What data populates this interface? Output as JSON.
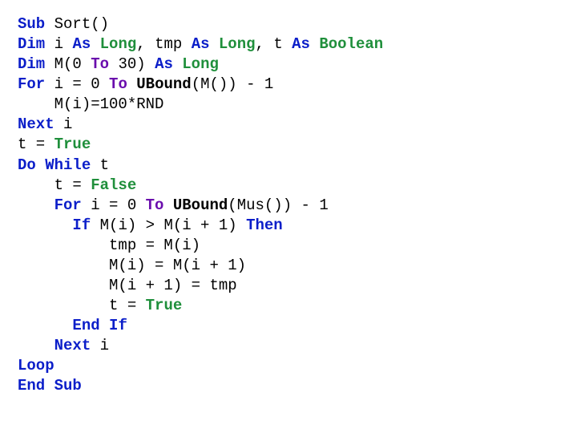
{
  "code": {
    "line1": {
      "sub": "Sub",
      "name": " Sort()"
    },
    "line2": {
      "dim": "Dim",
      "seg1": " i ",
      "as1": "As",
      "sp1": " ",
      "t1": "Long",
      "c1": ", tmp ",
      "as2": "As",
      "sp2": " ",
      "t2": "Long",
      "c2": ", t ",
      "as3": "As",
      "sp3": " ",
      "t3": "Boolean"
    },
    "line3": {
      "dim": "Dim",
      "seg": " M(0 ",
      "to": "To",
      "seg2": " 30) ",
      "as": "As",
      "sp": " ",
      "t": "Long"
    },
    "line4": {
      "for": "For",
      "seg1": " i = 0 ",
      "to": "To",
      "sp": " ",
      "ub": "UBound",
      "seg2": "(M()) - 1"
    },
    "line5": {
      "body": "    M(i)=100*RND"
    },
    "line6": {
      "next": "Next",
      "seg": " i"
    },
    "line7": {
      "seg": "t = ",
      "val": "True"
    },
    "line8": {
      "do": "Do",
      "sp": " ",
      "wh": "While",
      "seg": " t"
    },
    "line9": {
      "pad": "    t = ",
      "val": "False"
    },
    "line10": {
      "pad": "    ",
      "for": "For",
      "seg1": " i = 0 ",
      "to": "To",
      "sp": " ",
      "ub": "UBound",
      "seg2": "(Mus()) - 1"
    },
    "line11": {
      "pad": "      ",
      "if": "If",
      "seg": " M(i) > M(i + 1) ",
      "then": "Then"
    },
    "line12": {
      "body": "          tmp = M(i)"
    },
    "line13": {
      "body": "          M(i) = M(i + 1)"
    },
    "line14": {
      "body": "          M(i + 1) = tmp"
    },
    "line15": {
      "pad": "          t = ",
      "val": "True"
    },
    "line16": {
      "pad": "      ",
      "end": "End",
      "sp": " ",
      "if": "If"
    },
    "line17": {
      "pad": "    ",
      "next": "Next",
      "seg": " i"
    },
    "line18": {
      "loop": "Loop"
    },
    "line19": {
      "end": "End",
      "sp": " ",
      "sub": "Sub"
    }
  }
}
